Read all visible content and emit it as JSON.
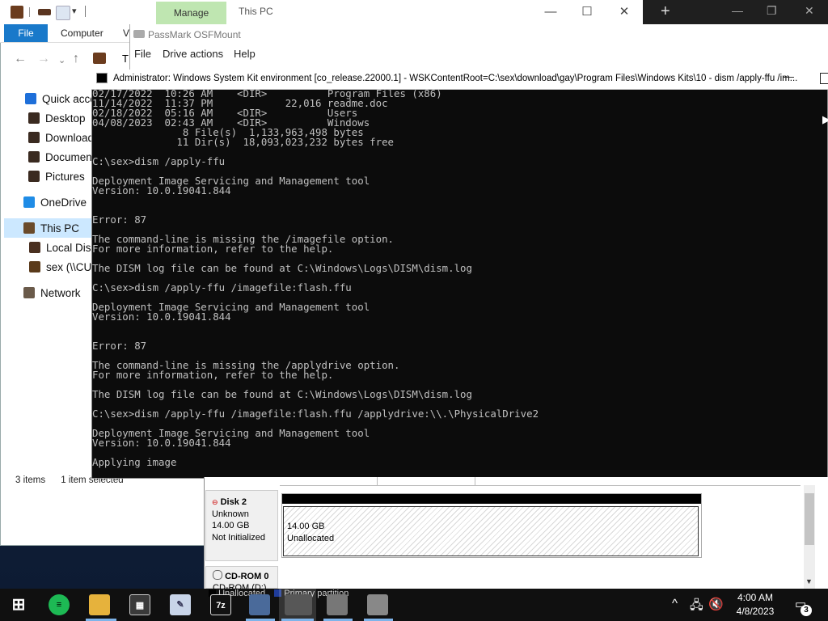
{
  "explorer": {
    "manage_tab": "Manage",
    "title": "This PC",
    "ribbon_file": "File",
    "ribbon_computer": "Computer",
    "ribbon_view": "V",
    "address_prefix": "T",
    "sidebar": [
      {
        "label": "Quick access",
        "icon": "star-icon",
        "color": "#1e6fd9"
      },
      {
        "label": "Desktop",
        "icon": "folder-icon",
        "color": "#3a2a20"
      },
      {
        "label": "Downloads",
        "icon": "folder-icon",
        "color": "#3a2a20"
      },
      {
        "label": "Documents",
        "icon": "folder-icon",
        "color": "#3a2a20"
      },
      {
        "label": "Pictures",
        "icon": "folder-icon",
        "color": "#3a2a20"
      },
      {
        "label": "OneDrive",
        "icon": "cloud-icon",
        "color": "#1f8ce6"
      },
      {
        "label": "This PC",
        "icon": "computer-icon",
        "color": "#6a4a2a"
      },
      {
        "label": "Local Disk",
        "icon": "drive-icon",
        "color": "#4a3020"
      },
      {
        "label": "sex (\\\\CU",
        "icon": "network-drive-icon",
        "color": "#5a3a1a"
      },
      {
        "label": "Network",
        "icon": "network-icon",
        "color": "#6a5a4a"
      }
    ],
    "status_items": "3 items",
    "status_selected": "1 item selected"
  },
  "osfmount": {
    "title": "PassMark OSFMount",
    "menu": [
      "File",
      "Drive actions",
      "Help"
    ]
  },
  "cmd": {
    "title": "Administrator:  Windows System Kit environment [co_release.22000.1] - WSKContentRoot=C:\\sex\\download\\gay\\Program Files\\Windows Kits\\10 - dism  /apply-ffu /im...",
    "lines": [
      "02/17/2022  10:26 AM    <DIR>          Program Files (x86)",
      "11/14/2022  11:37 PM            22,016 readme.doc",
      "02/18/2022  05:16 AM    <DIR>          Users",
      "04/08/2023  02:43 AM    <DIR>          Windows",
      "               8 File(s)  1,133,963,498 bytes",
      "              11 Dir(s)  18,093,023,232 bytes free",
      "",
      "C:\\sex>dism /apply-ffu",
      "",
      "Deployment Image Servicing and Management tool",
      "Version: 10.0.19041.844",
      "",
      "",
      "Error: 87",
      "",
      "The command-line is missing the /imagefile option.",
      "For more information, refer to the help.",
      "",
      "The DISM log file can be found at C:\\Windows\\Logs\\DISM\\dism.log",
      "",
      "C:\\sex>dism /apply-ffu /imagefile:flash.ffu",
      "",
      "Deployment Image Servicing and Management tool",
      "Version: 10.0.19041.844",
      "",
      "",
      "Error: 87",
      "",
      "The command-line is missing the /applydrive option.",
      "For more information, refer to the help.",
      "",
      "The DISM log file can be found at C:\\Windows\\Logs\\DISM\\dism.log",
      "",
      "C:\\sex>dism /apply-ffu /imagefile:flash.ffu /applydrive:\\\\.\\PhysicalDrive2",
      "",
      "Deployment Image Servicing and Management tool",
      "Version: 10.0.19041.844",
      "",
      "Applying image"
    ]
  },
  "diskmgmt": {
    "disk2": {
      "name": "Disk 2",
      "type": "Unknown",
      "size": "14.00 GB",
      "state": "Not Initialized"
    },
    "disk2_volume": {
      "size": "14.00 GB",
      "status": "Unallocated"
    },
    "cdrom": {
      "name": "CD-ROM 0",
      "sub": "CD-ROM (D:)"
    },
    "legend": [
      "Unallocated",
      "Primary partition"
    ]
  },
  "taskbar": {
    "clock_time": "4:00 AM",
    "clock_date": "4/8/2023",
    "notification_count": "3",
    "sevenzip_label": "7z"
  }
}
